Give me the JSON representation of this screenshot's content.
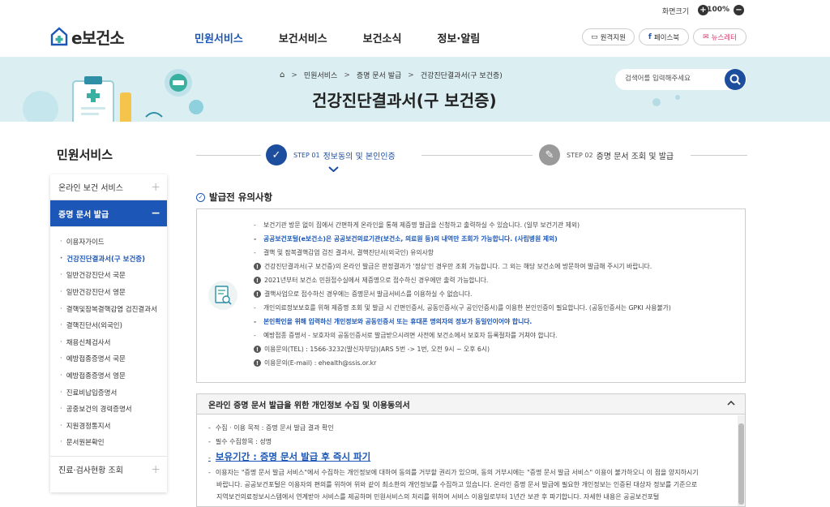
{
  "topbar": {
    "zoom_label": "화면크기",
    "zoom_in": "+",
    "zoom_value": "100%",
    "zoom_out": "−"
  },
  "header": {
    "logo_text": "e보건소",
    "nav": [
      "민원서비스",
      "보건서비스",
      "보건소식",
      "정보·알림"
    ],
    "btn_remote": "원격지원",
    "btn_facebook": "페이스북",
    "btn_newsletter": "뉴스레터"
  },
  "banner": {
    "breadcrumb": [
      "민원서비스",
      "증명 문서 발급",
      "건강진단결과서(구 보건증)"
    ],
    "page_title": "건강진단결과서(구 보건증)",
    "search_placeholder": "검색어를 입력해주세요"
  },
  "lnb": {
    "title": "민원서비스",
    "group1": "온라인 보건 서비스",
    "group2": "증명 문서 발급",
    "group3": "진료·검사현황 조회",
    "items": [
      "이용자가이드",
      "건강진단결과서(구 보건증)",
      "일반건강진단서 국문",
      "일반건강진단서 영문",
      "결핵및잠복결핵감염 검진결과서",
      "결핵진단서(외국인)",
      "채용신체검사서",
      "예방접종증명서 국문",
      "예방접종증명서 영문",
      "진료비납입증명서",
      "공중보건의 경력증명서",
      "지원경정통지서",
      "문서원본확인"
    ]
  },
  "steps": {
    "step1_num": "STEP 01",
    "step1_label": "정보동의 및 본인인증",
    "step2_num": "STEP 02",
    "step2_label": "증명 문서 조회 및 발급"
  },
  "notice": {
    "heading": "발급전 유의사항",
    "lines": [
      {
        "t": "d",
        "text": "보건기관 방문 없이 집에서 간편하게 온라인을 통해 제증명 발급을 신청하고 출력하실 수 있습니다. (일부 보건기관 제외)"
      },
      {
        "t": "db",
        "text": "공공보건포털(e보건소)은 공공보건의료기관(보건소, 의료원 등)의 내역만 조회가 가능합니다. (사립병원 제외)"
      },
      {
        "t": "d",
        "text": "결핵 및 잠복결핵감염 검진 결과서, 결핵진단서(외국인) 유의사항"
      },
      {
        "t": "w",
        "text": "건강진단결과서(구 보건증)의 온라인 발급은 판정결과가 '정상'인 경우만 조회 가능합니다. 그 외는 해당 보건소에 방문하여 발급해 주시기 바랍니다."
      },
      {
        "t": "w",
        "text": "2021년부터 보건소 민원접수실에서 제증명으로 접수하신 경우에만 출력 가능합니다."
      },
      {
        "t": "w",
        "text": "결핵사업으로 접수하신 경우에는 증명문서 발급서비스를 이용하실 수 없습니다."
      },
      {
        "t": "d",
        "text": "개인의료정보보호를 위해 제증명 조회 및 발급 시 간편인증서, 공동인증서(구 공인인증서)를 이용한 본인인증이 필요합니다. (공동인증서는 GPKI 사용불가)"
      },
      {
        "t": "db",
        "text": "본인확인을 위해 입력하신 개인정보와 공동인증서 또는 휴대폰 명의자의 정보가 동일인이어야 합니다."
      },
      {
        "t": "d",
        "text": "예방접종 증명서 - 보호자의 공동인증서로 발급받으시려면 사전에 보건소에서 보호자 등록절차를 거쳐야 합니다."
      },
      {
        "t": "w",
        "text": "이용문의(TEL) : 1566-3232(발신자부담)(ARS 5번 -> 1번, 오전 9시 ~ 오후 6시)"
      },
      {
        "t": "w",
        "text": "이용문의(E-mail) : ehealth@ssis.or.kr"
      }
    ]
  },
  "consent": {
    "heading": "온라인 증명 문서 발급을 위한 개인정보 수집 및 이용동의서",
    "purpose": "수집 · 이용 목적 : 증명 문서 발급 결과 확인",
    "items": "필수 수집항목 : 성명",
    "retention": "보유기간 : 증명 문서 발급 후 즉시 파기",
    "p1": "이용자는 \"증명 문서 발급 서비스\"에서 수집하는 개인정보에 대하여 동의를 거부할 권리가 있으며, 동의 거부시에는 \"증명 문서 발급 서비스\" 이용이 불가하오니 이 점을 양지하시기",
    "p2": "바랍니다. 공공보건포털은 이용자의 편의를 위하여 위와 같이 최소한의 개인정보를 수집하고 있습니다. 온라인 증명 문서 발급에 필요한 개인정보는 인증된 대상자 정보를 기준으로",
    "p3": "지역보건의료정보시스템에서 연계받아 서비스를 제공하며 민원서비스의 처리를 위하여 서비스 이용일로부터 1년간 보관 후 파기합니다. 자세한 내용은 공공보건포털"
  },
  "colors": {
    "accent": "#1c57b7",
    "banner": "#dbeff3",
    "step_active": "#1d4e9e",
    "step_inactive": "#9a9a9a"
  }
}
